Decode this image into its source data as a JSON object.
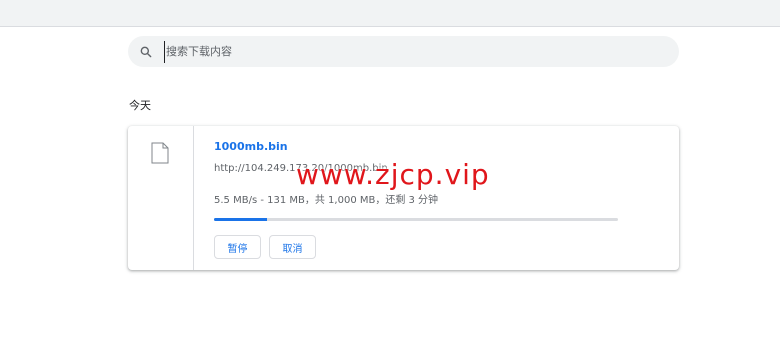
{
  "search": {
    "placeholder": "搜索下载内容"
  },
  "section": {
    "date_header": "今天"
  },
  "download": {
    "file_name": "1000mb.bin",
    "url": "http://104.249.173.20/1000mb.bin",
    "progress_text": "5.5 MB/s - 131 MB，共 1,000 MB，还剩 3 分钟",
    "progress_fraction": 0.131,
    "pause_label": "暂停",
    "cancel_label": "取消"
  },
  "watermark": {
    "text": "www.zjcp.vip"
  },
  "colors": {
    "accent": "#1a73e8",
    "watermark": "#e0161b"
  }
}
